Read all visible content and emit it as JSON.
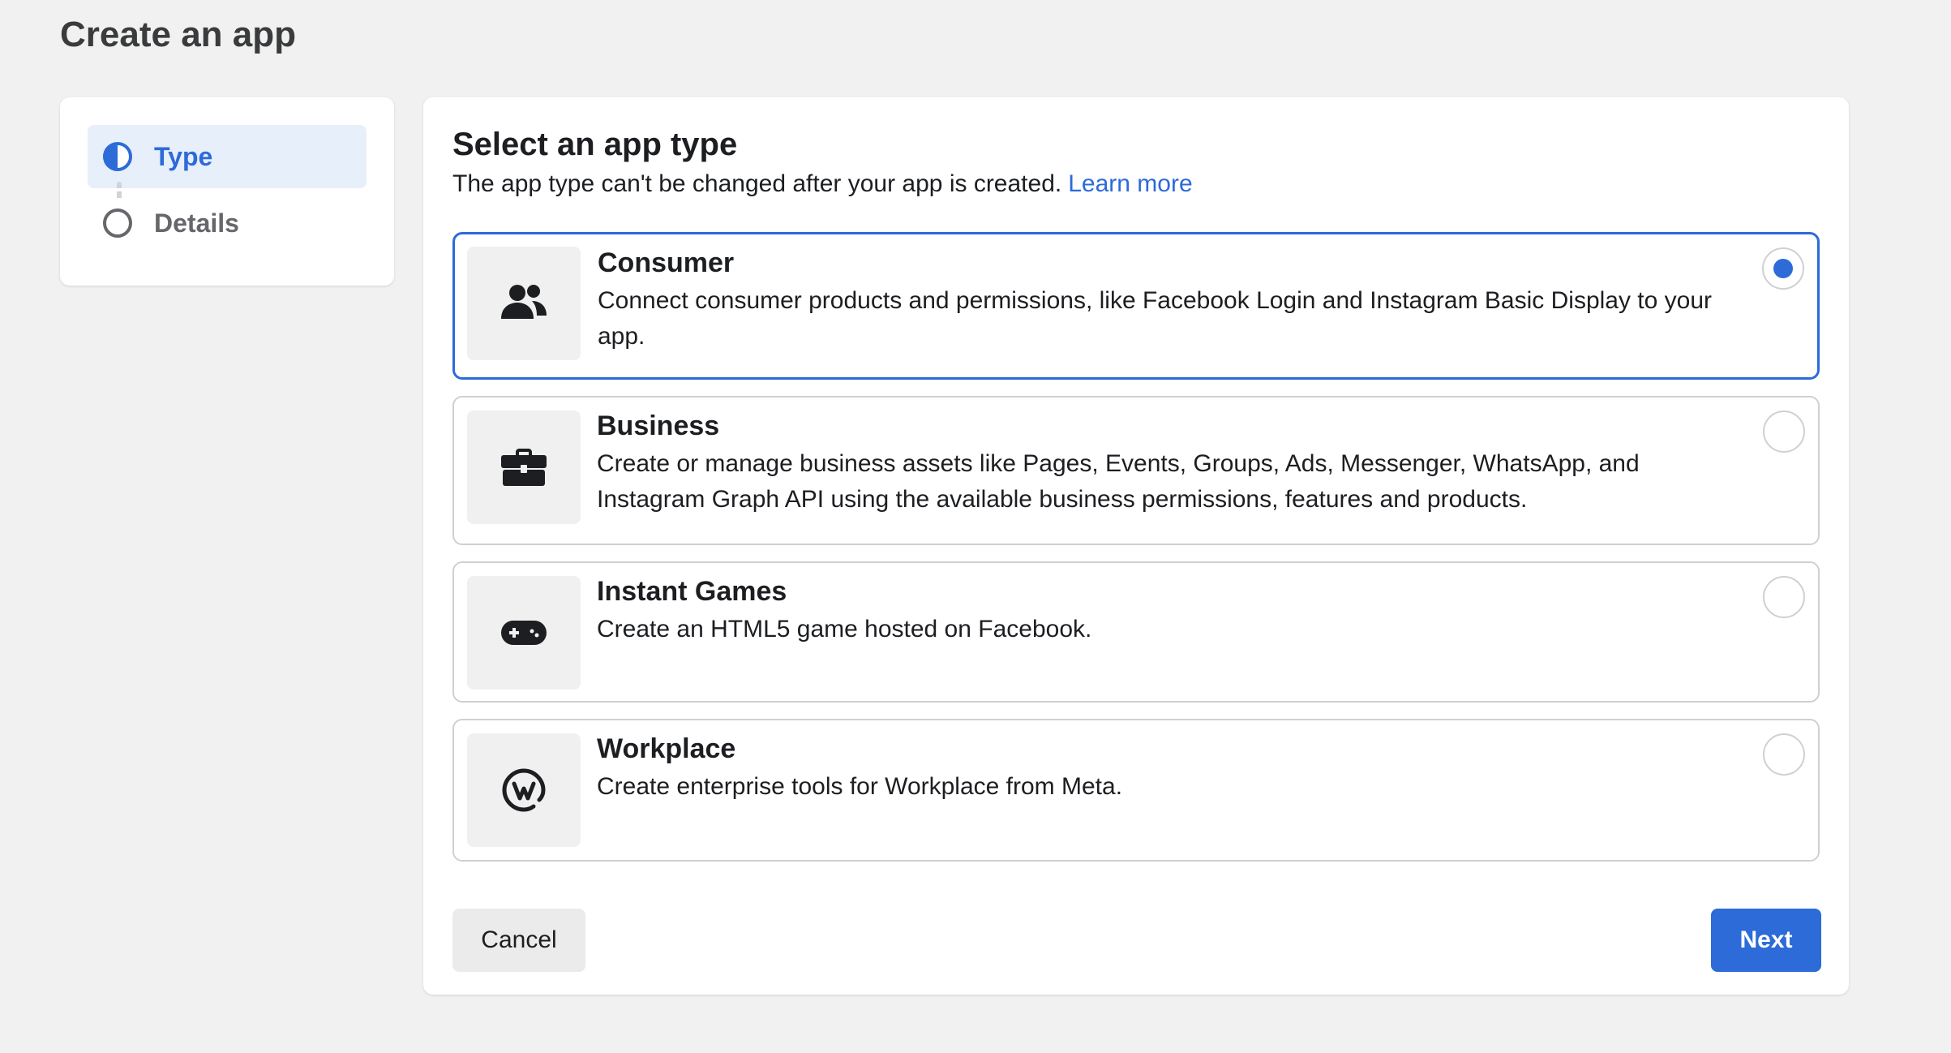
{
  "page": {
    "title": "Create an app"
  },
  "stepper": {
    "steps": [
      {
        "label": "Type",
        "state": "active"
      },
      {
        "label": "Details",
        "state": "inactive"
      }
    ]
  },
  "main": {
    "title": "Select an app type",
    "subtitle": "The app type can't be changed after your app is created.",
    "learn_more": "Learn more",
    "options": [
      {
        "title": "Consumer",
        "description": "Connect consumer products and permissions, like Facebook Login and Instagram Basic Display to your app.",
        "icon": "people-icon",
        "selected": true
      },
      {
        "title": "Business",
        "description": "Create or manage business assets like Pages, Events, Groups, Ads, Messenger, WhatsApp, and Instagram Graph API using the available business permissions, features and products.",
        "icon": "briefcase-icon",
        "selected": false
      },
      {
        "title": "Instant Games",
        "description": "Create an HTML5 game hosted on Facebook.",
        "icon": "gamepad-icon",
        "selected": false
      },
      {
        "title": "Workplace",
        "description": "Create enterprise tools for Workplace from Meta.",
        "icon": "workplace-logo-icon",
        "selected": false
      }
    ]
  },
  "actions": {
    "cancel_label": "Cancel",
    "next_label": "Next"
  },
  "colors": {
    "accent": "#2c6bd8",
    "background": "#f1f1f1",
    "border": "#ced0d4"
  }
}
